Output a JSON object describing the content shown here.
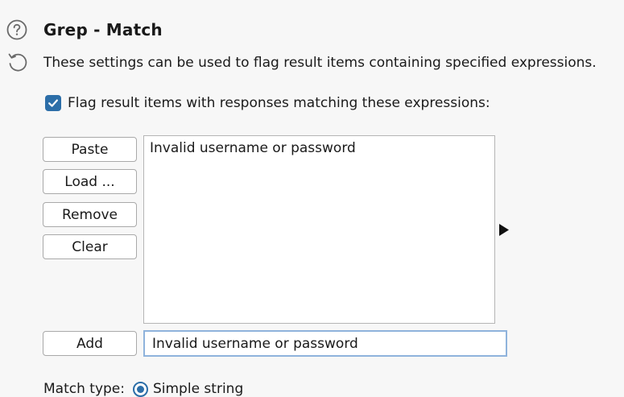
{
  "section": {
    "title": "Grep - Match",
    "description": "These settings can be used to flag result items containing specified expressions.",
    "help_icon": "question-circle-icon",
    "reset_icon": "reset-icon"
  },
  "flag_checkbox": {
    "label": "Flag result items with responses matching these expressions:",
    "checked": true
  },
  "buttons": {
    "paste": "Paste",
    "load": "Load ...",
    "remove": "Remove",
    "clear": "Clear",
    "add": "Add"
  },
  "expressions": [
    "Invalid username or password"
  ],
  "new_expression_input": {
    "value": "Invalid username or password"
  },
  "match_type": {
    "label": "Match type:",
    "selected": "Simple string"
  },
  "colors": {
    "accent": "#2c6ea8",
    "focus_border": "#8fb3dc"
  }
}
